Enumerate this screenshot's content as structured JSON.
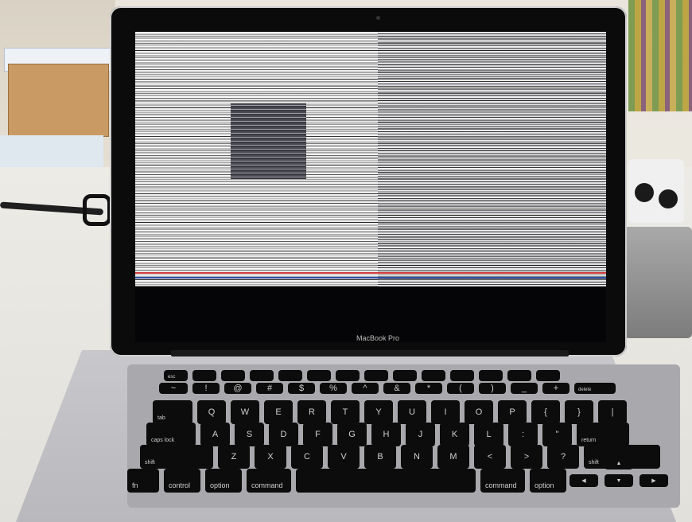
{
  "scene": {
    "description_alt": "",
    "laptop": {
      "logo_text": "MacBook Pro"
    }
  },
  "keyboard": {
    "fn_row": [
      "esc",
      "",
      "",
      "",
      "",
      "",
      "",
      "",
      "",
      "",
      "",
      "",
      "",
      ""
    ],
    "number_row": [
      "~",
      "!",
      "@",
      "#",
      "$",
      "%",
      "^",
      "&",
      "*",
      "(",
      ")",
      "_",
      "+",
      "delete"
    ],
    "qwerty_row": [
      "tab",
      "Q",
      "W",
      "E",
      "R",
      "T",
      "Y",
      "U",
      "I",
      "O",
      "P",
      "{",
      "}",
      "|"
    ],
    "home_row": [
      "caps lock",
      "A",
      "S",
      "D",
      "F",
      "G",
      "H",
      "J",
      "K",
      "L",
      ":",
      "\"",
      "return"
    ],
    "bottom_letter_row": [
      "shift",
      "Z",
      "X",
      "C",
      "V",
      "B",
      "N",
      "M",
      "<",
      ">",
      "?",
      "shift"
    ],
    "modifier_row": [
      "fn",
      "control",
      "option",
      "command",
      "",
      "command",
      "option"
    ],
    "arrows": [
      "◀",
      "▲",
      "▼",
      "▶"
    ]
  }
}
